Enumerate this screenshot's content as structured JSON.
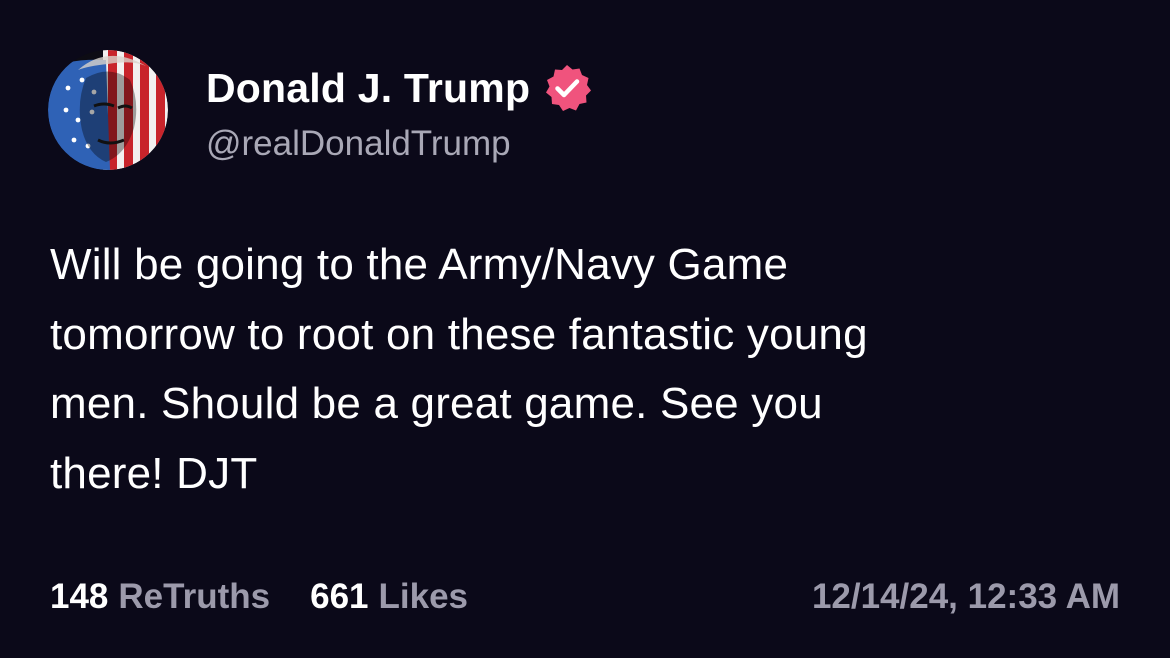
{
  "author": {
    "display_name": "Donald J. Trump",
    "handle": "@realDonaldTrump",
    "verified_icon": "verified-badge-icon",
    "verified_color": "#f0537d",
    "avatar_icon": "flag-painted-face-avatar"
  },
  "post": {
    "lines": [
      "Will be going to the Army/Navy Game",
      "tomorrow to root on these fantastic young",
      "men. Should be a great game. See you",
      "there! DJT"
    ]
  },
  "stats": {
    "retruths_count": "148",
    "retruths_label": "ReTruths",
    "likes_count": "661",
    "likes_label": "Likes"
  },
  "timestamp": "12/14/24, 12:33 AM",
  "colors": {
    "background": "#0b0919",
    "text_primary": "#ffffff",
    "text_secondary": "#9c9aab"
  }
}
